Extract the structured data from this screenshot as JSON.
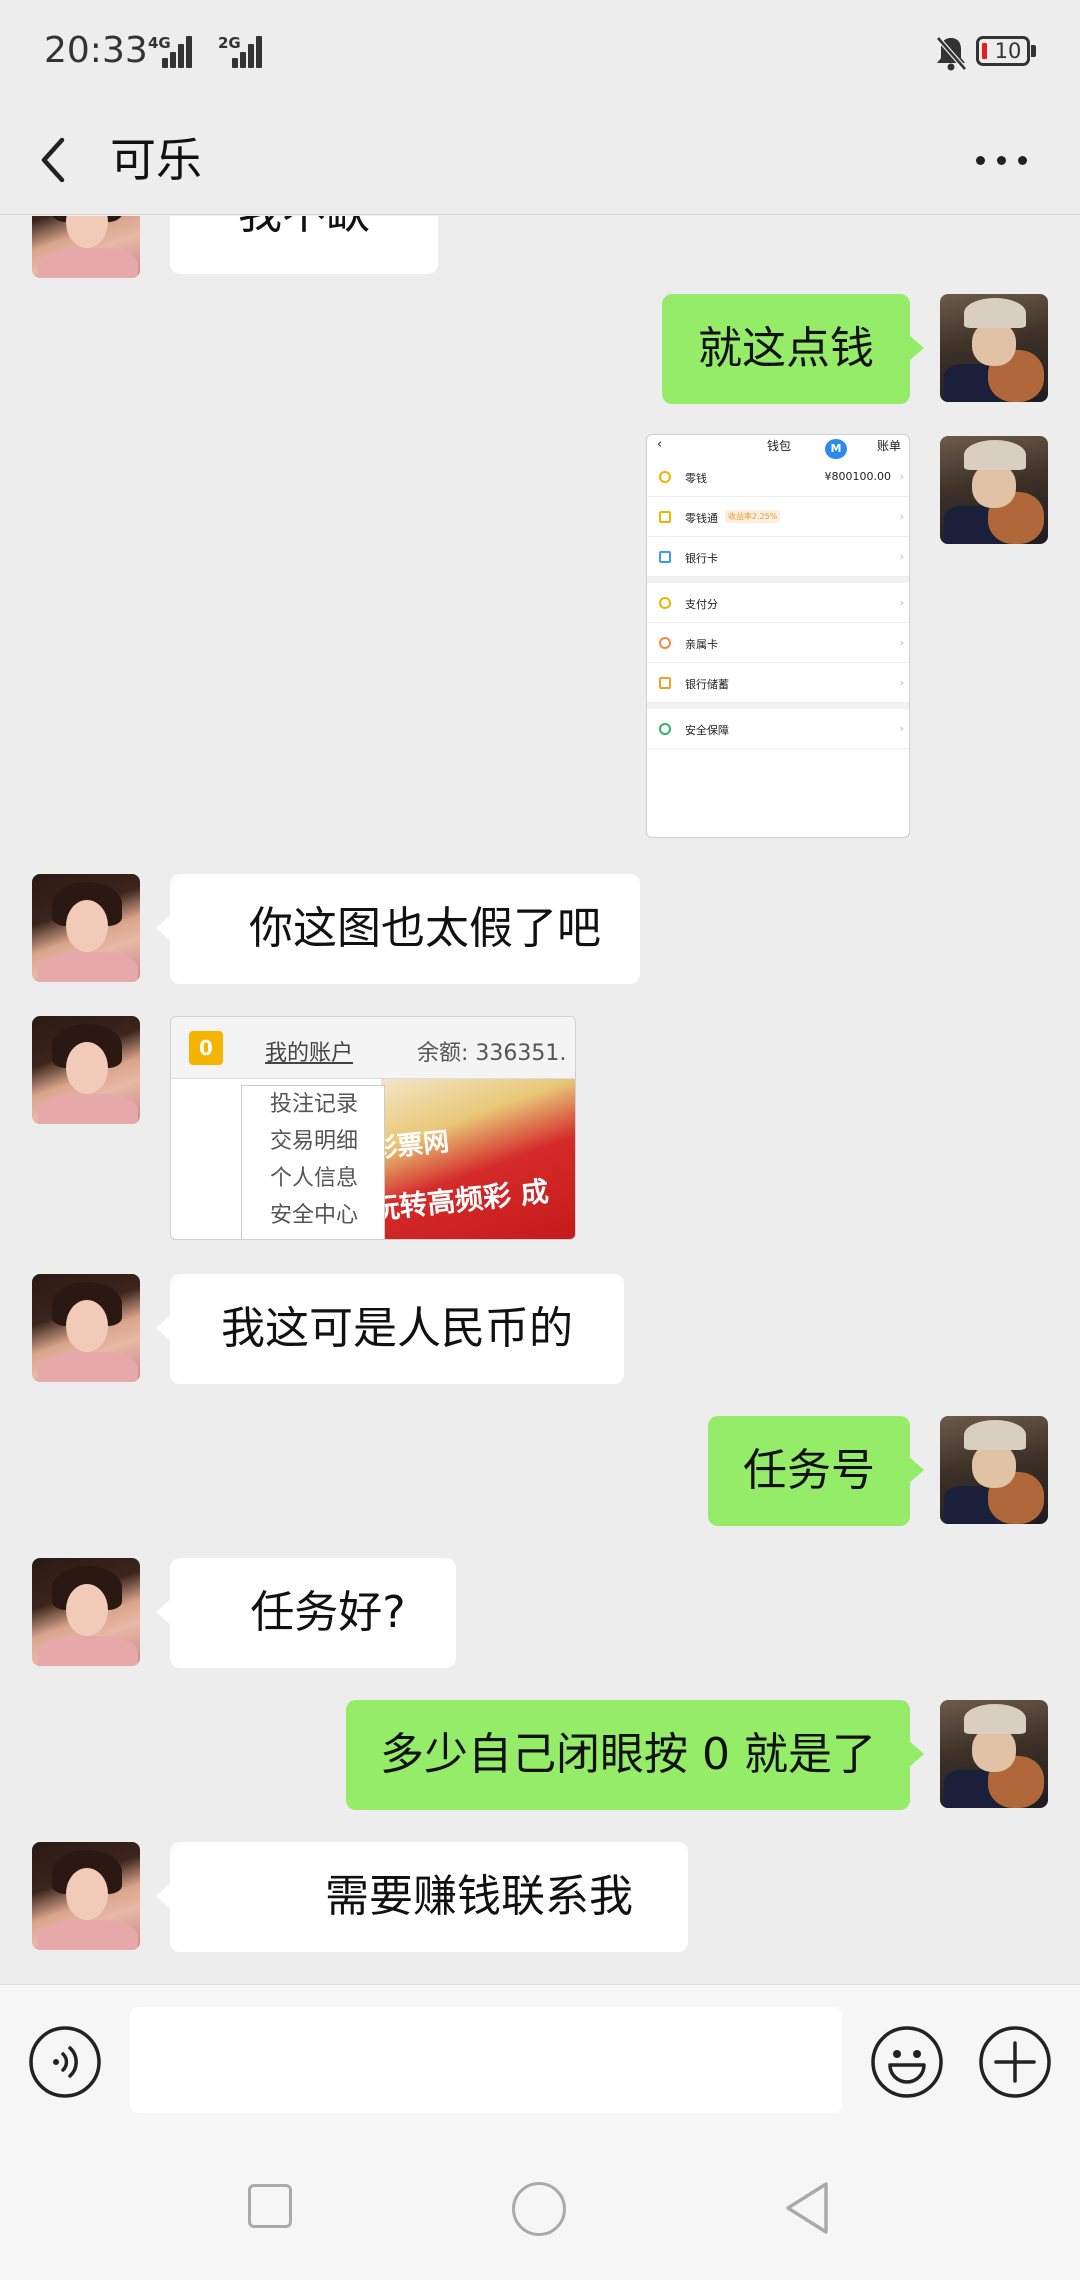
{
  "status_bar": {
    "time": "20:33",
    "net1": "4G",
    "net2": "2G",
    "battery": "10"
  },
  "header": {
    "title": "可乐"
  },
  "messages": {
    "partial_top": "我不缺",
    "m1": "就这点钱",
    "wallet": {
      "title": "钱包",
      "bill": "账单",
      "rows": [
        {
          "label": "零钱",
          "value": "¥800100.00"
        },
        {
          "label": "零钱通",
          "tag": "收益率2.25%"
        },
        {
          "label": "银行卡"
        },
        {
          "label": "支付分"
        },
        {
          "label": "亲属卡"
        },
        {
          "label": "银行储蓄"
        },
        {
          "label": "安全保障"
        }
      ]
    },
    "m2": "你这图也太假了吧",
    "lottery": {
      "account": "我的账户",
      "balance": "余额: 336351.",
      "menu": [
        "投注记录",
        "交易明细",
        "个人信息",
        "安全中心"
      ],
      "banner1": "彩票网",
      "banner2": "玩转高频彩 成"
    },
    "m3": "我这可是人民币的",
    "m4": "任务号",
    "m5": "任务好?",
    "m6": "多少自己闭眼按 0 就是了",
    "m7": "需要赚钱联系我"
  }
}
